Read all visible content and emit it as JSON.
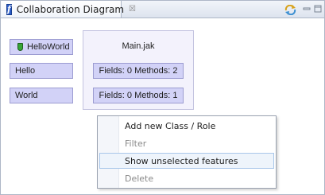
{
  "tab": {
    "title": "Collaboration Diagram",
    "close_glyph": "☒",
    "icon_letter": "f",
    "icon_name": "featureide-icon"
  },
  "toolbar": {
    "sync_icon": "sync-arrows-icon",
    "minimize_icon": "minimize-icon",
    "maximize_icon": "maximize-icon"
  },
  "diagram": {
    "roles": [
      {
        "label": "HelloWorld",
        "has_marker": true
      },
      {
        "label": "Hello",
        "has_marker": false
      },
      {
        "label": "World",
        "has_marker": false
      }
    ],
    "class": {
      "title": "Main.jak",
      "fields": [
        "Fields: 0 Methods: 2",
        "Fields: 0 Methods: 1"
      ]
    }
  },
  "context_menu": {
    "items": [
      {
        "label": "Add new Class / Role",
        "enabled": true,
        "selected": false
      },
      {
        "label": "Filter",
        "enabled": false,
        "selected": false
      },
      {
        "label": "Show unselected features",
        "enabled": true,
        "selected": true
      },
      {
        "label": "Delete",
        "enabled": false,
        "selected": false
      }
    ]
  },
  "colors": {
    "role_fill": "#d2d2f7",
    "role_border": "#9c9cd1",
    "class_fill": "#f3f2fc",
    "marker_green": "#37a637",
    "selection": "#eef4fb"
  }
}
